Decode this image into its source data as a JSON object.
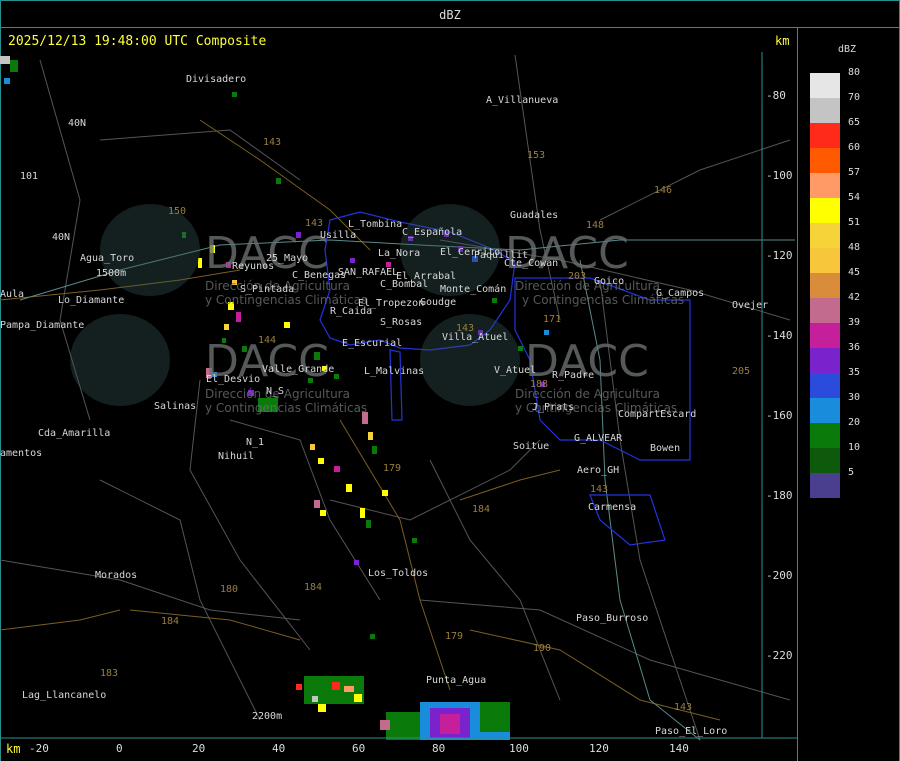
{
  "header": {
    "title": "dBZ"
  },
  "map": {
    "timestamp": "2025/12/13 19:48:00 UTC Composite",
    "km_top": "km",
    "km_bottom": "km",
    "y_ticks": [
      "-80",
      "-100",
      "-120",
      "-140",
      "-160",
      "-180",
      "-200",
      "-220"
    ],
    "x_ticks": [
      "-20",
      "0",
      "20",
      "40",
      "60",
      "80",
      "100",
      "120",
      "140"
    ],
    "places": [
      "Divisadero",
      "A_Villanueva",
      "40N",
      "101",
      "40N",
      "Agua_Toro",
      "1500m",
      "Aula",
      "Pampa_Diamante",
      "Lo_Diamante",
      "Cda_Amarilla",
      "amentos",
      "Salinas",
      "El_Desvio",
      "N_1",
      "Nihuil",
      "Valle_Grande",
      "L_Malvinas",
      "E_Escurial",
      "R_Caida",
      "S_Rosas",
      "El_Tropezon",
      "Goudge",
      "C_Bombal",
      "C_Benegas",
      "SAN_RAFAEL",
      "El_Arrabal",
      "La_Nora",
      "C_Española",
      "Usilla",
      "L_Tombina",
      "El_Cerrito",
      "Paquillit",
      "Cte_Cowan",
      "Guadales",
      "Goico",
      "G_Campos",
      "Ovejer",
      "Villa_Atuel",
      "V_Atuel",
      "R_Padre",
      "J_Prats",
      "CompartEscard",
      "G_ALVEAR",
      "Bowen",
      "Soitue",
      "Aero_GH",
      "Carmensa",
      "Los_Toldos",
      "Morados",
      "Paso_Burroso",
      "Punta_Agua",
      "Lag_Llancanelo",
      "Paso_El_Loro",
      "2200m",
      "S_Pintada",
      "Reyunos",
      "25_Mayo",
      "N_S",
      "Monte_Comán"
    ],
    "routes": [
      "143",
      "153",
      "146",
      "150",
      "143",
      "148",
      "203",
      "171",
      "143",
      "188",
      "143",
      "144",
      "179",
      "184",
      "180",
      "184",
      "184",
      "183",
      "179",
      "190",
      "143",
      "205"
    ],
    "watermark": {
      "logo": "DACC",
      "line1": "Dirección de Agricultura",
      "line2": "y Contingencias Climáticas"
    }
  },
  "legend": {
    "unit": "dBZ",
    "levels": [
      {
        "label": "80",
        "color": "#e6e6e6"
      },
      {
        "label": "70",
        "color": "#c4c4c4"
      },
      {
        "label": "65",
        "color": "#ff2a1a"
      },
      {
        "label": "60",
        "color": "#ff5a00"
      },
      {
        "label": "57",
        "color": "#ff9966"
      },
      {
        "label": "54",
        "color": "#ffff00"
      },
      {
        "label": "51",
        "color": "#f7d33a"
      },
      {
        "label": "48",
        "color": "#f7c63a"
      },
      {
        "label": "45",
        "color": "#d98c3a"
      },
      {
        "label": "42",
        "color": "#c26b8f"
      },
      {
        "label": "39",
        "color": "#c61f9c"
      },
      {
        "label": "36",
        "color": "#7a22cc"
      },
      {
        "label": "35",
        "color": "#2a4bdc"
      },
      {
        "label": "30",
        "color": "#1a8cdc"
      },
      {
        "label": "20",
        "color": "#0a7a0a"
      },
      {
        "label": "10",
        "color": "#0d5a0d"
      },
      {
        "label": "5",
        "color": "#4a3f8f"
      }
    ]
  }
}
